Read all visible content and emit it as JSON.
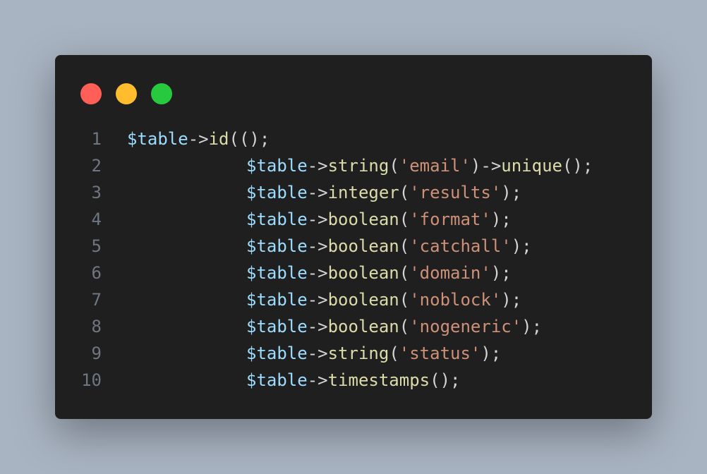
{
  "colors": {
    "background": "#a9b4c2",
    "editor_bg": "#1f1f1f",
    "dot_red": "#ff5f56",
    "dot_yellow": "#ffbd2e",
    "dot_green": "#27c93f",
    "variable": "#9cdcfe",
    "function": "#dcdcaa",
    "string": "#ce9178",
    "punctuation": "#d4d4d4",
    "line_number": "#6e7681"
  },
  "window_controls": [
    "close-dot",
    "minimize-dot",
    "maximize-dot"
  ],
  "lines": [
    {
      "number": "1",
      "var": "$table",
      "arrow": "->",
      "fn": "id",
      "open": "(",
      "str": "",
      "close": "();",
      "chain_arrow": "",
      "chain_fn": "",
      "chain_close": ""
    },
    {
      "number": "2",
      "var": "$table",
      "arrow": "->",
      "fn": "string",
      "open": "(",
      "str": "'email'",
      "close": ")",
      "chain_arrow": "->",
      "chain_fn": "unique",
      "chain_close": "();"
    },
    {
      "number": "3",
      "var": "$table",
      "arrow": "->",
      "fn": "integer",
      "open": "(",
      "str": "'results'",
      "close": ");",
      "chain_arrow": "",
      "chain_fn": "",
      "chain_close": ""
    },
    {
      "number": "4",
      "var": "$table",
      "arrow": "->",
      "fn": "boolean",
      "open": "(",
      "str": "'format'",
      "close": ");",
      "chain_arrow": "",
      "chain_fn": "",
      "chain_close": ""
    },
    {
      "number": "5",
      "var": "$table",
      "arrow": "->",
      "fn": "boolean",
      "open": "(",
      "str": "'catchall'",
      "close": ");",
      "chain_arrow": "",
      "chain_fn": "",
      "chain_close": ""
    },
    {
      "number": "6",
      "var": "$table",
      "arrow": "->",
      "fn": "boolean",
      "open": "(",
      "str": "'domain'",
      "close": ");",
      "chain_arrow": "",
      "chain_fn": "",
      "chain_close": ""
    },
    {
      "number": "7",
      "var": "$table",
      "arrow": "->",
      "fn": "boolean",
      "open": "(",
      "str": "'noblock'",
      "close": ");",
      "chain_arrow": "",
      "chain_fn": "",
      "chain_close": ""
    },
    {
      "number": "8",
      "var": "$table",
      "arrow": "->",
      "fn": "boolean",
      "open": "(",
      "str": "'nogeneric'",
      "close": ");",
      "chain_arrow": "",
      "chain_fn": "",
      "chain_close": ""
    },
    {
      "number": "9",
      "var": "$table",
      "arrow": "->",
      "fn": "string",
      "open": "(",
      "str": "'status'",
      "close": ");",
      "chain_arrow": "",
      "chain_fn": "",
      "chain_close": ""
    },
    {
      "number": "10",
      "var": "$table",
      "arrow": "->",
      "fn": "timestamps",
      "open": "(",
      "str": "",
      "close": ");",
      "chain_arrow": "",
      "chain_fn": "",
      "chain_close": ""
    }
  ]
}
